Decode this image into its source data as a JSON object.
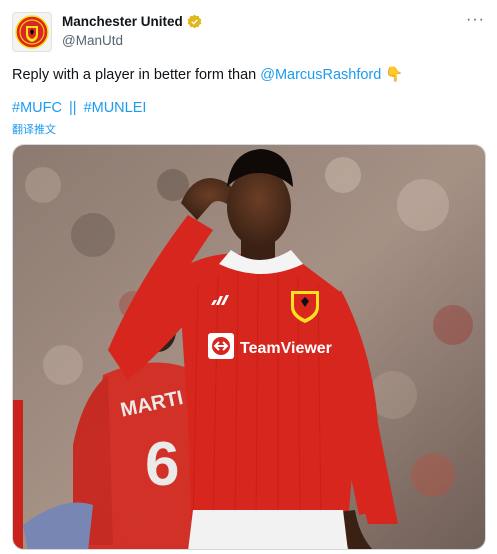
{
  "author": {
    "name": "Manchester United",
    "handle": "@ManUtd",
    "verified": true,
    "avatar_icon": "manutd-crest-icon"
  },
  "menu": {
    "more_label": "···"
  },
  "tweet": {
    "text_before": "Reply with a player in better form than ",
    "mention": "@MarcusRashford",
    "emoji": "👇",
    "hashtag_1": "#MUFC",
    "separator": "||",
    "hashtag_2": "#MUNLEI",
    "translate_label": "翻译推文"
  },
  "media": {
    "shirt_sponsor": "TeamViewer",
    "kit_brand_icon": "adidas-logo-icon",
    "back_player_name": "MARTI",
    "back_player_number": "6"
  },
  "colors": {
    "link": "#1d9bf0",
    "kit_red": "#d7261e",
    "verified_gold": "#e2b719"
  }
}
